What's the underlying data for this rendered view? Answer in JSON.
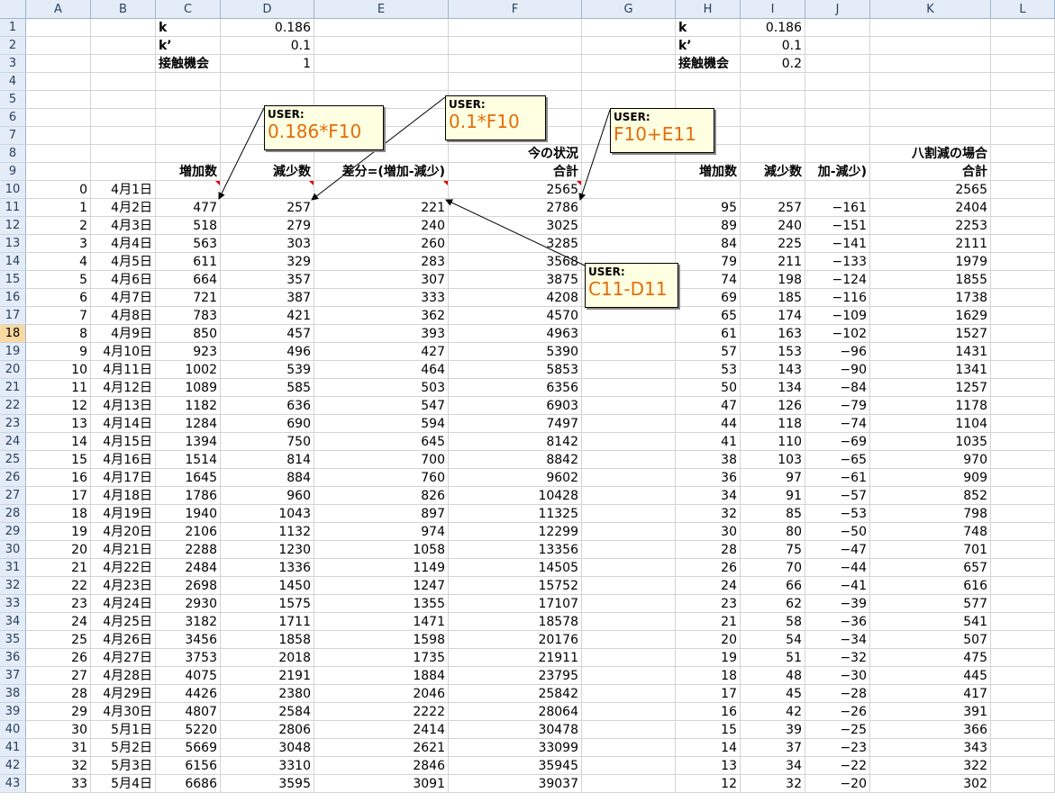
{
  "columns": [
    "A",
    "B",
    "C",
    "D",
    "E",
    "F",
    "G",
    "H",
    "I",
    "J",
    "K",
    "L"
  ],
  "selected_row": 18,
  "cells": {
    "C1": "k",
    "D1": "0.186",
    "C2": "k’",
    "D2": "0.1",
    "C3": "接触機会",
    "D3": "1",
    "H1": "k",
    "I1": "0.186",
    "H2": "k’",
    "I2": "0.1",
    "H3": "接触機会",
    "I3": "0.2",
    "F8": "今の状況",
    "K8": "八割減の場合",
    "C9": "増加数",
    "D9": "減少数",
    "E9": "差分=(増加-減少)",
    "F9": "合計",
    "H9": "増加数",
    "I9": "減少数",
    "J9": "加-減少)",
    "K9": "合計"
  },
  "table": {
    "days": [
      0,
      1,
      2,
      3,
      4,
      5,
      6,
      7,
      8,
      9,
      10,
      11,
      12,
      13,
      14,
      15,
      16,
      17,
      18,
      19,
      20,
      21,
      22,
      23,
      24,
      25,
      26,
      27,
      28,
      29,
      30,
      31,
      32,
      33
    ],
    "dates": [
      "4月1日",
      "4月2日",
      "4月3日",
      "4月4日",
      "4月5日",
      "4月6日",
      "4月7日",
      "4月8日",
      "4月9日",
      "4月10日",
      "4月11日",
      "4月12日",
      "4月13日",
      "4月14日",
      "4月15日",
      "4月16日",
      "4月17日",
      "4月18日",
      "4月19日",
      "4月20日",
      "4月21日",
      "4月22日",
      "4月23日",
      "4月24日",
      "4月25日",
      "4月26日",
      "4月27日",
      "4月28日",
      "4月29日",
      "4月30日",
      "5月1日",
      "5月2日",
      "5月3日",
      "5月4日"
    ],
    "increase": [
      "",
      477,
      518,
      563,
      611,
      664,
      721,
      783,
      850,
      923,
      1002,
      1089,
      1182,
      1284,
      1394,
      1514,
      1645,
      1786,
      1940,
      2106,
      2288,
      2484,
      2698,
      2930,
      3182,
      3456,
      3753,
      4075,
      4426,
      4807,
      5220,
      5669,
      6156,
      6686
    ],
    "decrease": [
      "",
      257,
      279,
      303,
      329,
      357,
      387,
      421,
      457,
      496,
      539,
      585,
      636,
      690,
      750,
      814,
      884,
      960,
      1043,
      1132,
      1230,
      1336,
      1450,
      1575,
      1711,
      1858,
      2018,
      2191,
      2380,
      2584,
      2806,
      3048,
      3310,
      3595
    ],
    "diff": [
      "",
      221,
      240,
      260,
      283,
      307,
      333,
      362,
      393,
      427,
      464,
      503,
      547,
      594,
      645,
      700,
      760,
      826,
      897,
      974,
      1058,
      1149,
      1247,
      1355,
      1471,
      1598,
      1735,
      1884,
      2046,
      2222,
      2414,
      2621,
      2846,
      3091
    ],
    "total": [
      2565,
      2786,
      3025,
      3285,
      3568,
      3875,
      4208,
      4570,
      4963,
      5390,
      5853,
      6356,
      6903,
      7497,
      8142,
      8842,
      9602,
      10428,
      11325,
      12299,
      13356,
      14505,
      15752,
      17107,
      18578,
      20176,
      21911,
      23795,
      25842,
      28064,
      30478,
      33099,
      35945,
      39037
    ],
    "alt_increase": [
      "",
      95,
      89,
      84,
      79,
      74,
      69,
      65,
      61,
      57,
      53,
      50,
      47,
      44,
      41,
      38,
      36,
      34,
      32,
      30,
      28,
      26,
      24,
      23,
      21,
      20,
      19,
      18,
      17,
      16,
      15,
      14,
      13,
      12
    ],
    "alt_decrease": [
      "",
      257,
      240,
      225,
      211,
      198,
      185,
      174,
      163,
      153,
      143,
      134,
      126,
      118,
      110,
      103,
      97,
      91,
      85,
      80,
      75,
      70,
      66,
      62,
      58,
      54,
      51,
      48,
      45,
      42,
      39,
      37,
      34,
      32
    ],
    "alt_diff": [
      "",
      -161,
      -151,
      -141,
      -133,
      -124,
      -116,
      -109,
      -102,
      -96,
      -90,
      -84,
      -79,
      -74,
      -69,
      -65,
      -61,
      -57,
      -53,
      -50,
      -47,
      -44,
      -41,
      -39,
      -36,
      -34,
      -32,
      -30,
      -28,
      -26,
      -25,
      -23,
      -22,
      -20
    ],
    "alt_total": [
      2565,
      2404,
      2253,
      2111,
      1979,
      1855,
      1738,
      1629,
      1527,
      1431,
      1341,
      1257,
      1178,
      1104,
      1035,
      970,
      909,
      852,
      798,
      748,
      701,
      657,
      616,
      577,
      541,
      507,
      475,
      445,
      417,
      391,
      366,
      343,
      322,
      302
    ]
  },
  "comments": [
    {
      "id": "c1",
      "author": "USER:",
      "text": "0.186*F10"
    },
    {
      "id": "c2",
      "author": "USER:",
      "text": "0.1*F10"
    },
    {
      "id": "c3",
      "author": "USER:",
      "text": "F10+E11"
    },
    {
      "id": "c4",
      "author": "USER:",
      "text": "C11-D11"
    }
  ]
}
